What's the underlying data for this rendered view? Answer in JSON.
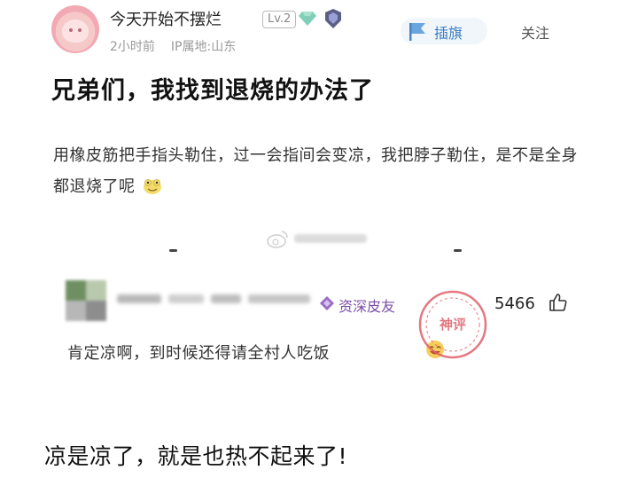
{
  "post": {
    "username": "今天开始不摆烂",
    "level": "Lv.2",
    "time": "2小时前",
    "ip_location": "IP属地:山东",
    "flag_button_label": "插旗",
    "follow_label": "关注",
    "title": "兄弟们，我找到退烧的办法了",
    "body": "用橡皮筋把手指头勒住，过一会指间会变凉，我把脖子勒住，是不是全身都退烧了呢",
    "icons": [
      "gem-icon",
      "medal-icon",
      "flag-icon",
      "emoji-icon",
      "weibo-icon"
    ]
  },
  "comment": {
    "badge": "资深皮友",
    "like_count": "5466",
    "text": "肯定凉啊，到时候还得请全村人吃饭",
    "icons": [
      "vip-icon",
      "thumbs-up-icon",
      "emoji-icon"
    ]
  },
  "stamp": {
    "text": "神评"
  },
  "caption": "凉是凉了，就是也热不起来了!",
  "colors": {
    "link_blue": "#3a7ec0",
    "badge_purple": "#7b4ea6",
    "stamp_red": "#e0606a",
    "meta_gray": "#9a9a9a"
  }
}
